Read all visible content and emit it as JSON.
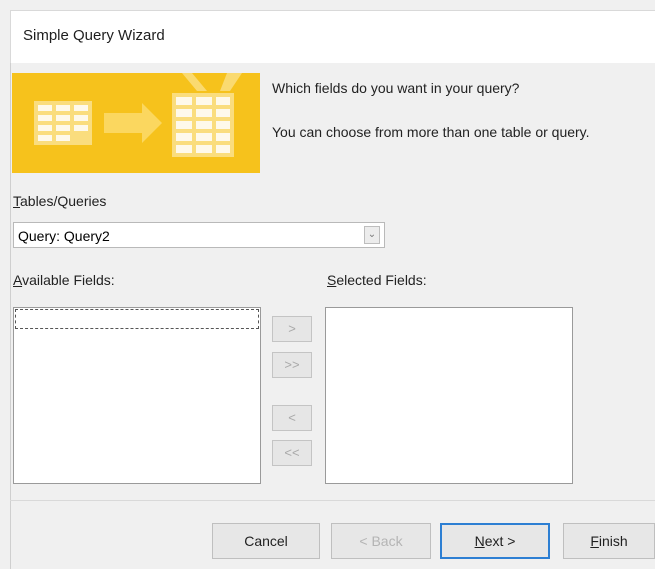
{
  "window": {
    "title": "Simple Query Wizard"
  },
  "colors": {
    "banner": "#f6c21c",
    "focus_border": "#2d7fd3"
  },
  "prompt": {
    "line1": "Which fields do you want in your query?",
    "line2": "You can choose from more than one table or query."
  },
  "tables_queries": {
    "label_accel": "T",
    "label_rest": "ables/Queries",
    "value": "Query: Query2"
  },
  "available": {
    "label_accel": "A",
    "label_rest": "vailable Fields:",
    "items": []
  },
  "selected": {
    "label_accel": "S",
    "label_rest": "elected Fields:",
    "items": []
  },
  "move_buttons": {
    "add_one": ">",
    "add_all": ">>",
    "remove_one": "<",
    "remove_all": "<<"
  },
  "footer": {
    "cancel": "Cancel",
    "back": "< Back",
    "next_accel": "N",
    "next_rest": "ext >",
    "finish_accel": "F",
    "finish_rest": "inish"
  }
}
